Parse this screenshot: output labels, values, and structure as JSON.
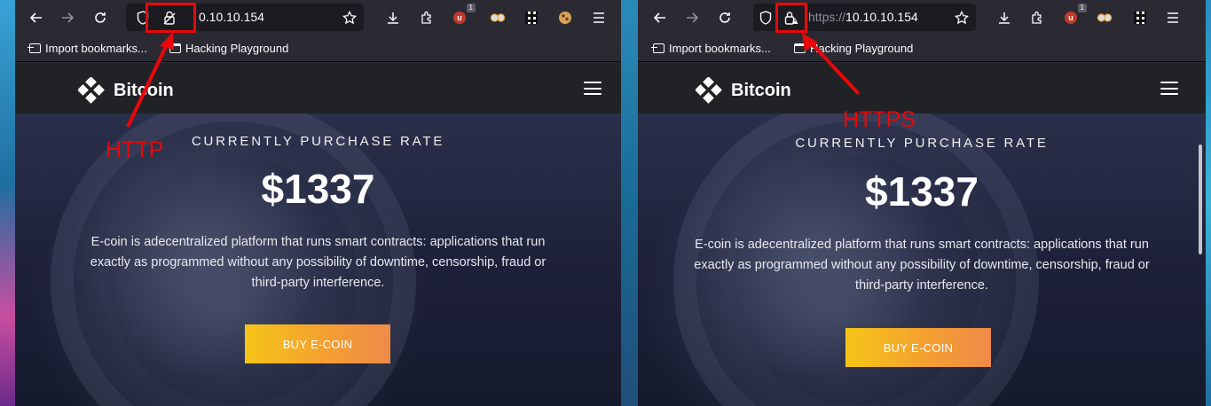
{
  "left_browser": {
    "url": "0.10.10.154",
    "bookmarks": [
      "Import bookmarks...",
      "Hacking Playground"
    ],
    "ublock_count": "1",
    "site": {
      "brand": "Bitcoin",
      "rate_label": "CURRENTLY PURCHASE RATE",
      "price": "$1337",
      "description": "E-coin is adecentralized platform that runs smart contracts: applications that run exactly as programmed without any possibility of downtime, censorship, fraud or third-party interference.",
      "button": "BUY E-COIN"
    }
  },
  "right_browser": {
    "url_scheme": "https://",
    "url_host": "10.10.10.154",
    "bookmarks": [
      "Import bookmarks...",
      "Hacking Playground"
    ],
    "ublock_count": "1",
    "site": {
      "brand": "Bitcoin",
      "rate_label": "CURRENTLY PURCHASE RATE",
      "price": "$1337",
      "description": "E-coin is adecentralized platform that runs smart contracts: applications that run exactly as programmed without any possibility of downtime, censorship, fraud or third-party interference.",
      "button": "BUY E-COIN"
    }
  },
  "annotations": {
    "left_label": "HTTP",
    "right_label": "HTTPS",
    "color": "#e8080a"
  },
  "icons": [
    "back-icon",
    "forward-icon",
    "reload-icon",
    "shield-icon",
    "lock-icon",
    "star-icon",
    "download-icon",
    "extensions-icon",
    "ublock-icon",
    "glasses-icon",
    "qr-icon",
    "cookie-icon",
    "menu-icon",
    "hamburger-icon"
  ]
}
